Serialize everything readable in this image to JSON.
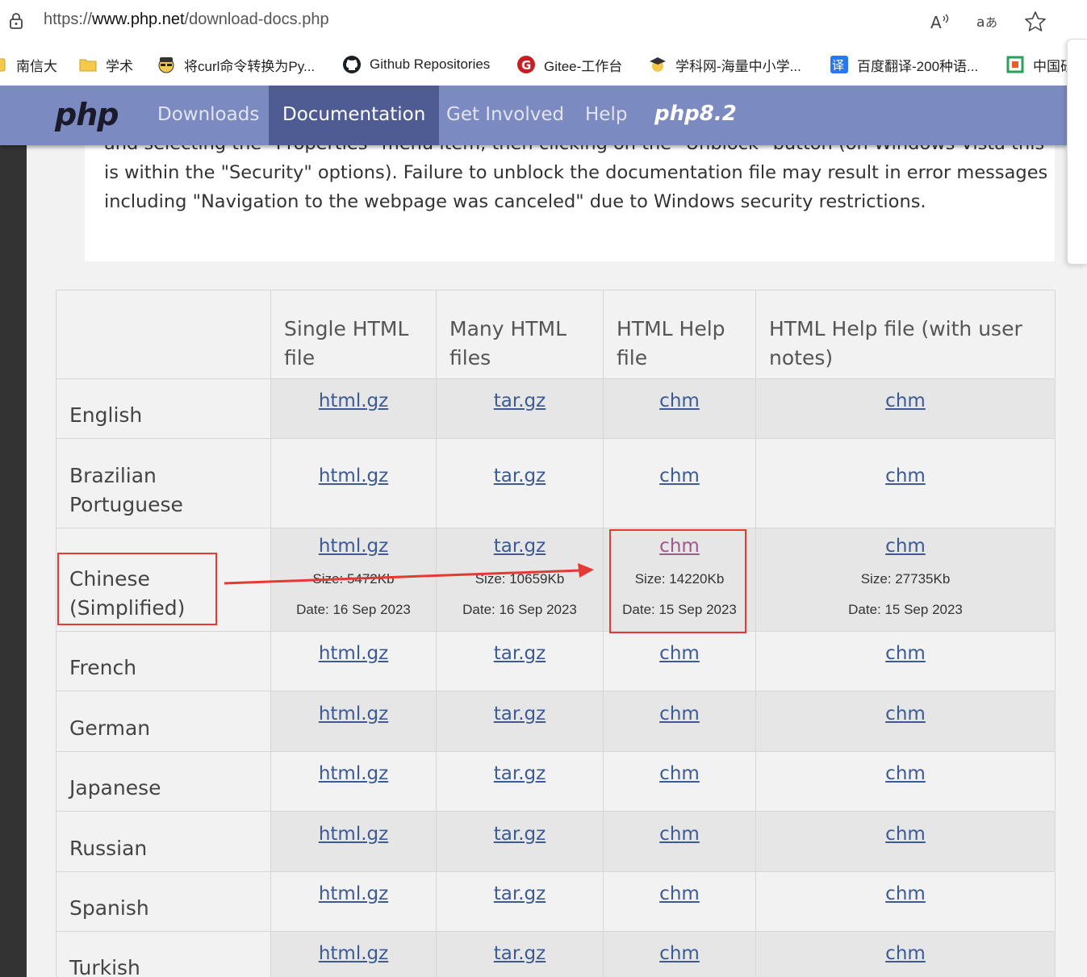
{
  "browser": {
    "url_prefix": "https://",
    "url_domain": "www.php.net",
    "url_path": "/download-docs.php",
    "bookmarks": [
      {
        "label": "南信大"
      },
      {
        "label": "学术"
      },
      {
        "label": "将curl命令转换为Py..."
      },
      {
        "label": "Github Repositories"
      },
      {
        "label": "Gitee-工作台"
      },
      {
        "label": "学科网-海量中小学..."
      },
      {
        "label": "百度翻译-200种语..."
      },
      {
        "label": "中国研"
      }
    ]
  },
  "nav": {
    "logo": "php",
    "links": [
      "Downloads",
      "Documentation",
      "Get Involved",
      "Help"
    ],
    "active": "Documentation",
    "version_badge": "php8.2"
  },
  "note": {
    "text": "format, you need to \"unblock\" the file after downloading it by right-clicking on it in Windows Explorer and selecting the \"Properties\" menu item, then clicking on the \"Unblock\" button (on Windows Vista this is within the \"Security\" options). Failure to unblock the documentation file may result in error messages including \"Navigation to the webpage was canceled\" due to Windows security restrictions."
  },
  "table": {
    "headers": [
      "",
      "Single HTML file",
      "Many HTML files",
      "HTML Help file",
      "HTML Help file (with user notes)"
    ],
    "rows": [
      {
        "lang": "English",
        "links": [
          "html.gz",
          "tar.gz",
          "chm",
          "chm"
        ]
      },
      {
        "lang": "Brazilian Portuguese",
        "links": [
          "html.gz",
          "tar.gz",
          "chm",
          "chm"
        ]
      },
      {
        "lang": "Chinese (Simplified)",
        "links": [
          "html.gz",
          "tar.gz",
          "chm",
          "chm"
        ],
        "sizes": [
          "Size: 5472Kb",
          "Size: 10659Kb",
          "Size: 14220Kb",
          "Size: 27735Kb"
        ],
        "dates": [
          "Date: 16 Sep 2023",
          "Date: 16 Sep 2023",
          "Date: 15 Sep 2023",
          "Date: 15 Sep 2023"
        ]
      },
      {
        "lang": "French",
        "links": [
          "html.gz",
          "tar.gz",
          "chm",
          "chm"
        ]
      },
      {
        "lang": "German",
        "links": [
          "html.gz",
          "tar.gz",
          "chm",
          "chm"
        ]
      },
      {
        "lang": "Japanese",
        "links": [
          "html.gz",
          "tar.gz",
          "chm",
          "chm"
        ]
      },
      {
        "lang": "Russian",
        "links": [
          "html.gz",
          "tar.gz",
          "chm",
          "chm"
        ]
      },
      {
        "lang": "Spanish",
        "links": [
          "html.gz",
          "tar.gz",
          "chm",
          "chm"
        ]
      },
      {
        "lang": "Turkish",
        "links": [
          "html.gz",
          "tar.gz",
          "chm",
          "chm"
        ]
      }
    ]
  },
  "colors": {
    "nav_bg": "#7b8ac0",
    "nav_active": "#4f5b93",
    "link": "#3c5a94",
    "visited_link": "#9b5a8a",
    "annotation": "#e53935"
  }
}
